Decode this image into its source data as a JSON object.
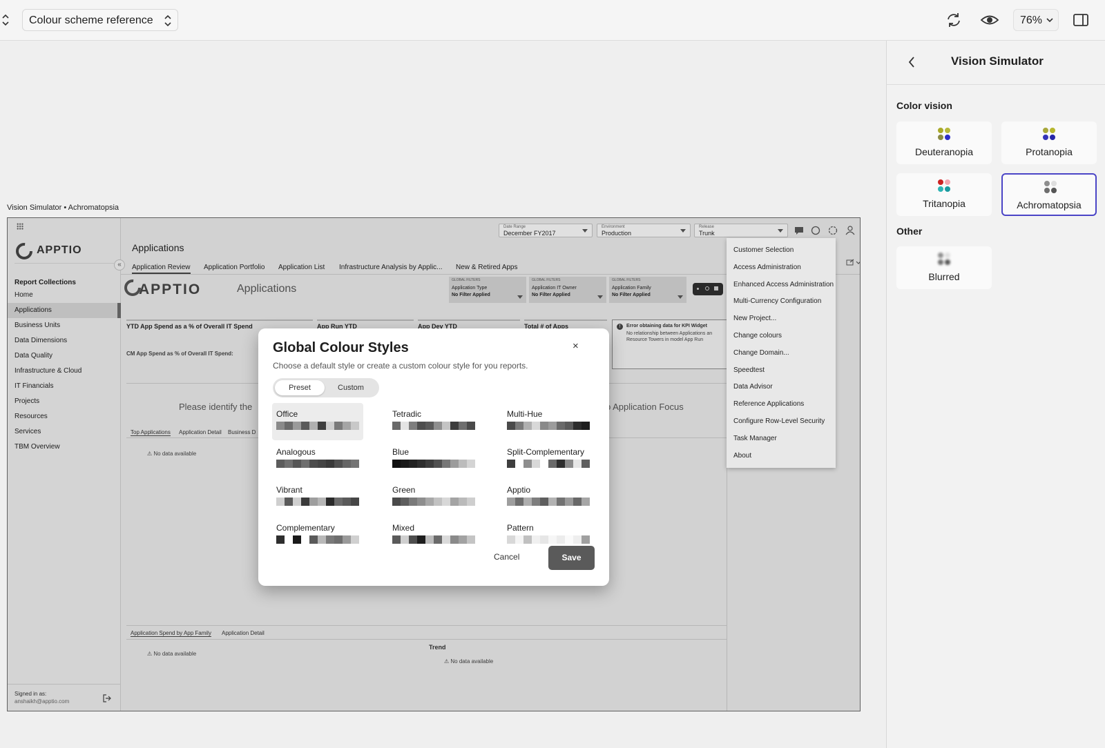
{
  "toolbar": {
    "document_select": "Colour scheme reference",
    "zoom": "76%"
  },
  "canvas": {
    "label": "Vision Simulator • Achromatopsia"
  },
  "app": {
    "nav": {
      "logo": "APPTIO",
      "heading": "Report Collections",
      "items": [
        "Home",
        "Applications",
        "Business Units",
        "Data Dimensions",
        "Data Quality",
        "Infrastructure & Cloud",
        "IT Financials",
        "Projects",
        "Resources",
        "Services",
        "TBM Overview"
      ],
      "active": "Applications",
      "signed_label": "Signed in as:",
      "signed_user": "anshaikh@apptio.com"
    },
    "filters": [
      {
        "small": "Date Range",
        "main": "December FY2017"
      },
      {
        "small": "Environment",
        "main": "Production"
      },
      {
        "small": "Release",
        "main": "Trunk"
      }
    ],
    "title": "Applications",
    "tabs": [
      "Application Review",
      "Application Portfolio",
      "Application List",
      "Infrastructure Analysis by Applic...",
      "New & Retired Apps"
    ],
    "big_logo": "APPTIO",
    "big_title": "Applications",
    "global_filters": [
      {
        "head": "GLOBAL FILTERS",
        "title": "Application Type",
        "value": "No Filter Applied"
      },
      {
        "head": "GLOBAL FILTERS",
        "title": "Application IT Owner",
        "value": "No Filter Applied"
      },
      {
        "head": "GLOBAL FILTERS",
        "title": "Application Family",
        "value": "No Filter Applied"
      }
    ],
    "kpis": [
      "YTD App Spend as a % of Overall IT Spend",
      "App Run YTD",
      "App Dev YTD",
      "Total # of Apps"
    ],
    "cm_spend": "CM App Spend as % of Overall IT Spend:",
    "error_title": "Error obtaining data for KPI Widget",
    "error_body_1": "No relationship between Applications an",
    "error_body_2": "Resource Towers in model App Run",
    "identify_text": "Please identify the",
    "focus_text": "p Application Focus",
    "sub_tabs": [
      "Top Applications",
      "Application Detail",
      "Business D"
    ],
    "no_data": "No data available",
    "bottom_tabs": [
      "Application Spend by App Family",
      "Application Detail"
    ],
    "trend": "Trend",
    "menu": [
      "Customer Selection",
      "Access Administration",
      "Enhanced Access Administration",
      "Multi-Currency Configuration",
      "New Project...",
      "Change colours",
      "Change Domain...",
      "Speedtest",
      "Data Advisor",
      "Reference Applications",
      "Configure Row-Level Security",
      "Task Manager",
      "About"
    ]
  },
  "modal": {
    "title": "Global Colour Styles",
    "close": "×",
    "subtitle": "Choose a default style or create a custom colour style for you reports.",
    "preset": "Preset",
    "custom": "Custom",
    "styles": [
      {
        "name": "Office",
        "colors": [
          "#8a8a8a",
          "#6b6b6b",
          "#9a9a9a",
          "#5a5a5a",
          "#b0b0b0",
          "#3e3e3e",
          "#cfcfcf",
          "#7a7a7a",
          "#a5a5a5",
          "#c8c8c8"
        ]
      },
      {
        "name": "Tetradic",
        "colors": [
          "#6a6a6a",
          "#e4e4e4",
          "#7e7e7e",
          "#4e4e4e",
          "#5a5a5a",
          "#8e8e8e",
          "#c4c4c4",
          "#3c3c3c",
          "#6e6e6e",
          "#4a4a4a"
        ]
      },
      {
        "name": "Multi-Hue",
        "colors": [
          "#4a4a4a",
          "#7a7a7a",
          "#b0b0b0",
          "#d8d8d8",
          "#8a8a8a",
          "#9c9c9c",
          "#6a6a6a",
          "#5a5a5a",
          "#2c2c2c",
          "#1e1e1e"
        ]
      },
      {
        "name": "Analogous",
        "colors": [
          "#5c5c5c",
          "#707070",
          "#565656",
          "#6e6e6e",
          "#4c4c4c",
          "#444444",
          "#3a3a3a",
          "#505050",
          "#666666",
          "#747474"
        ]
      },
      {
        "name": "Blue",
        "colors": [
          "#111111",
          "#1a1a1a",
          "#222222",
          "#2e2e2e",
          "#3c3c3c",
          "#505050",
          "#777777",
          "#9c9c9c",
          "#bcbcbc",
          "#d4d4d4"
        ]
      },
      {
        "name": "Split-Complementary",
        "colors": [
          "#3e3e3e",
          "#ffffff",
          "#8e8e8e",
          "#d8d8d8",
          "#ffffff",
          "#6a6a6a",
          "#2e2e2e",
          "#8a8a8a",
          "#e6e6e6",
          "#5e5e5e"
        ]
      },
      {
        "name": "Vibrant",
        "colors": [
          "#cfcfcf",
          "#5a5a5a",
          "#d0d0d0",
          "#3a3a3a",
          "#9e9e9e",
          "#b6b6b6",
          "#2a2a2a",
          "#6a6a6a",
          "#5a5a5a",
          "#464646"
        ]
      },
      {
        "name": "Green",
        "colors": [
          "#4a4a4a",
          "#5e5e5e",
          "#7a7a7a",
          "#8e8e8e",
          "#a8a8a8",
          "#c2c2c2",
          "#d8d8d8",
          "#a4a4a4",
          "#bababa",
          "#cecece"
        ]
      },
      {
        "name": "Apptio",
        "colors": [
          "#9e9e9e",
          "#6e6e6e",
          "#aeaeae",
          "#7e7e7e",
          "#5e5e5e",
          "#b2b2b2",
          "#727272",
          "#9a9a9a",
          "#686868",
          "#a6a6a6"
        ]
      },
      {
        "name": "Complementary",
        "colors": [
          "#2e2e2e",
          "#ffffff",
          "#1a1a1a",
          "#ffffff",
          "#5a5a5a",
          "#b8b8b8",
          "#7a7a7a",
          "#6e6e6e",
          "#9a9a9a",
          "#d0d0d0"
        ]
      },
      {
        "name": "Mixed",
        "colors": [
          "#5a5a5a",
          "#cfcfcf",
          "#4e4e4e",
          "#1e1e1e",
          "#bcbcbc",
          "#6a6a6a",
          "#dadada",
          "#8a8a8a",
          "#a2a2a2",
          "#c4c4c4"
        ]
      },
      {
        "name": "Pattern",
        "colors": [
          "#d8d8d8",
          "#f4f4f4",
          "#c0c0c0",
          "#f0f0f0",
          "#e6e6e6",
          "#f6f6f6",
          "#ececec",
          "#fafafa",
          "#eeeeee",
          "#a0a0a0"
        ]
      }
    ],
    "cancel": "Cancel",
    "save": "Save"
  },
  "vision_panel": {
    "title": "Vision Simulator",
    "section_color": "Color vision",
    "section_other": "Other",
    "options": [
      {
        "label": "Deuteranopia",
        "dots": [
          "#a9a92a",
          "#b6b83a",
          "#8a8a44",
          "#2c2cc8"
        ]
      },
      {
        "label": "Protanopia",
        "dots": [
          "#a8a83a",
          "#b6b62e",
          "#3434b8",
          "#2626a8"
        ]
      },
      {
        "label": "Tritanopia",
        "dots": [
          "#cc2222",
          "#f4a6b0",
          "#2eb4b4",
          "#1a9aa0"
        ]
      },
      {
        "label": "Achromatopsia",
        "dots": [
          "#8e8e8e",
          "#dedede",
          "#6e6e6e",
          "#555555"
        ]
      }
    ],
    "other": [
      {
        "label": "Blurred",
        "dots": [
          "#8e8e8e",
          "#dedede",
          "#6e6e6e",
          "#555555"
        ]
      }
    ],
    "selected": "Achromatopsia",
    "accent": "#4a44c6"
  }
}
